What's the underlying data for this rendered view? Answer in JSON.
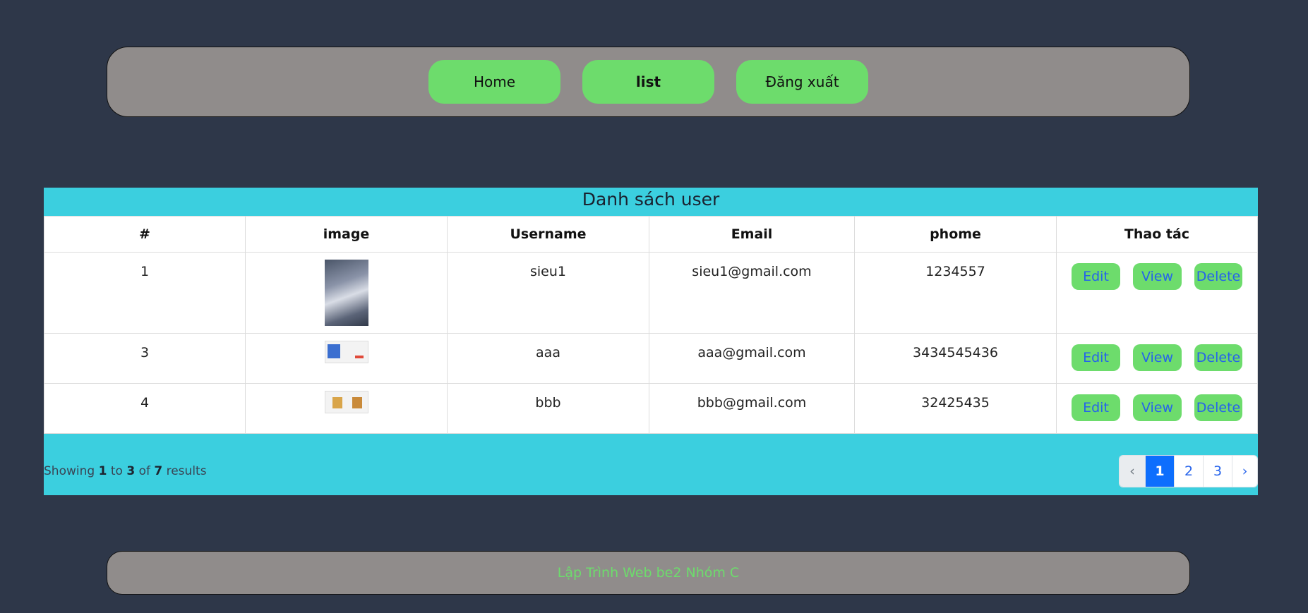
{
  "nav": {
    "home": "Home",
    "list": "list",
    "logout": "Đăng xuất"
  },
  "panel": {
    "title": "Danh sách user"
  },
  "table": {
    "headers": [
      "#",
      "image",
      "Username",
      "Email",
      "phome",
      "Thao tác"
    ],
    "rows": [
      {
        "id": "1",
        "username": "sieu1",
        "email": "sieu1@gmail.com",
        "phone": "1234557"
      },
      {
        "id": "3",
        "username": "aaa",
        "email": "aaa@gmail.com",
        "phone": "3434545436"
      },
      {
        "id": "4",
        "username": "bbb",
        "email": "bbb@gmail.com",
        "phone": "32425435"
      }
    ],
    "actions": {
      "edit": "Edit",
      "view": "View",
      "delete": "Delete"
    }
  },
  "pagination": {
    "showing_prefix": "Showing",
    "from": "1",
    "to_word": "to",
    "to": "3",
    "of_word": "of",
    "total": "7",
    "results_word": "results",
    "prev": "‹",
    "pages": [
      "1",
      "2",
      "3"
    ],
    "next": "›",
    "current_page": "1"
  },
  "footer": {
    "text": "Lập Trình Web be2 Nhóm C"
  },
  "colors": {
    "background": "#2e3749",
    "bar": "#908c8b",
    "button_green": "#6ddc6c",
    "panel_cyan": "#3bcfdf",
    "link_blue": "#2563eb",
    "active_page": "#0d6efd"
  }
}
